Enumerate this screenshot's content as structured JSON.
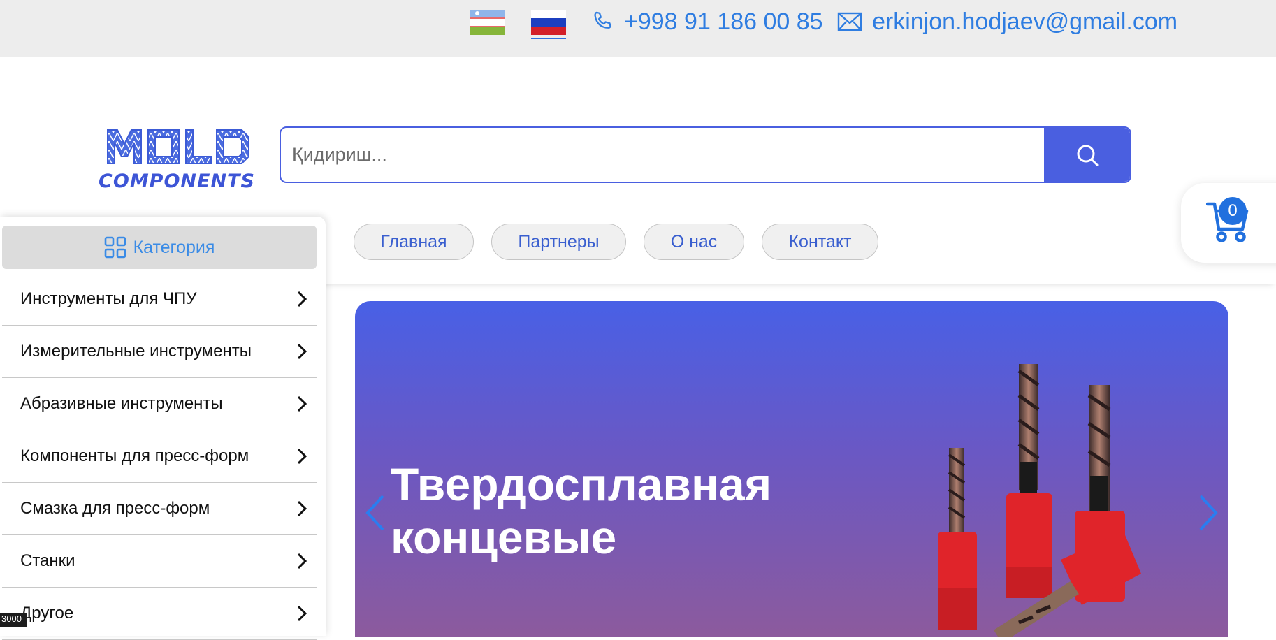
{
  "topbar": {
    "languages": [
      {
        "code": "uz",
        "flag": "uzbekistan-flag",
        "active": false
      },
      {
        "code": "ru",
        "flag": "russia-flag",
        "active": true
      }
    ],
    "phone": "+998 91 186 00 85",
    "email": "erkinjon.hodjaev@gmail.com"
  },
  "header": {
    "logo_text": {
      "top": "MOLD",
      "bottom": "COMPONENTS"
    },
    "search": {
      "placeholder": "Қидириш...",
      "value": ""
    },
    "cart_count": "0"
  },
  "nav": {
    "items": [
      "Главная",
      "Партнеры",
      "О нас",
      "Контакт"
    ]
  },
  "sidebar": {
    "header": "Категория",
    "items": [
      "Инструменты для ЧПУ",
      "Измерительные инструменты",
      "Абразивные инструменты",
      "Компоненты для пресс-форм",
      "Смазка для пресс-форм",
      "Станки",
      "Другое"
    ]
  },
  "banner": {
    "title_line1": "Твердосплавная",
    "title_line2": "концевые"
  },
  "corner_tag": "3000",
  "colors": {
    "accent": "#4a5fe0",
    "link": "#2f7de1",
    "topbar_bg": "#ededed",
    "badge": "#2170de"
  }
}
